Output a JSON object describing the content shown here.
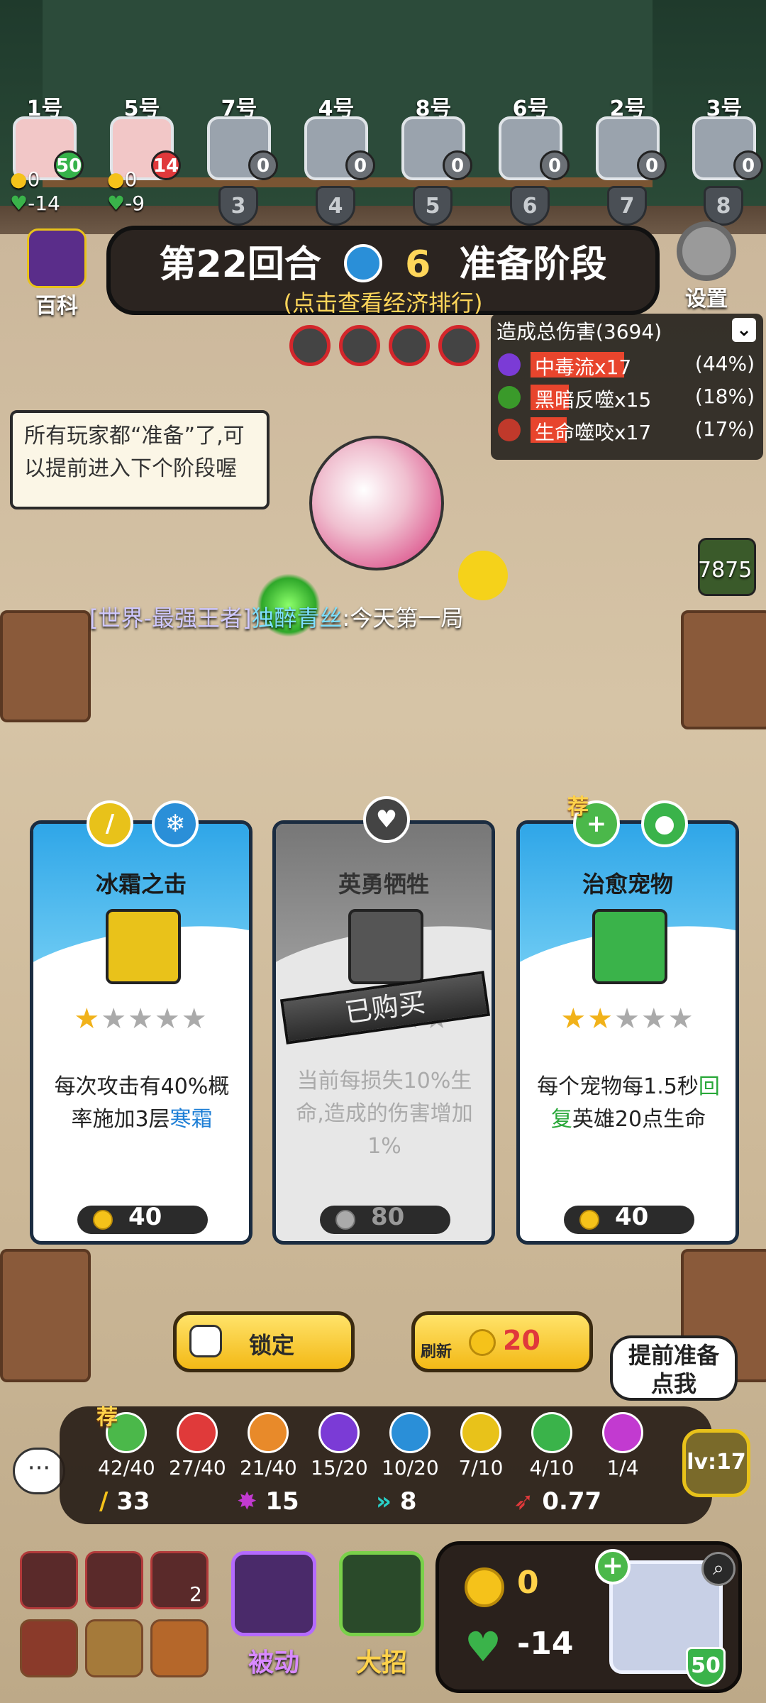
{
  "players": [
    {
      "seat": "1号",
      "level": "50",
      "gold": "0",
      "hp": "-14",
      "is_me": true
    },
    {
      "seat": "5号",
      "level": "14",
      "gold": "0",
      "hp": "-9"
    },
    {
      "seat": "7号",
      "level": "0",
      "rank": "3"
    },
    {
      "seat": "4号",
      "level": "0",
      "rank": "4"
    },
    {
      "seat": "8号",
      "level": "0",
      "rank": "5"
    },
    {
      "seat": "6号",
      "level": "0",
      "rank": "6"
    },
    {
      "seat": "2号",
      "level": "0",
      "rank": "7"
    },
    {
      "seat": "3号",
      "level": "0",
      "rank": "8"
    }
  ],
  "header": {
    "encyclopedia_label": "百科",
    "round_label": "第22回合",
    "timer": "6",
    "phase": "准备阶段",
    "subtitle": "(点击查看经济排行)",
    "settings_label": "设置"
  },
  "damage_panel": {
    "title": "造成总伤害(3694)",
    "rows": [
      {
        "label": "中毒流x17",
        "percent": "(44%)",
        "fill": 0.44,
        "icon_color": "#7b3bd6"
      },
      {
        "label": "黑暗反噬x15",
        "percent": "(18%)",
        "fill": 0.18,
        "icon_color": "#3a9a2a"
      },
      {
        "label": "生命噬咬x17",
        "percent": "(17%)",
        "fill": 0.17,
        "icon_color": "#c0392b"
      }
    ]
  },
  "tooltip": "所有玩家都“准备”了,可以提前进入下个阶段喔",
  "chat_line": {
    "prefix": "[世界-最强王者]",
    "name": "独醉青丝",
    "message": ":今天第一局"
  },
  "gem_counter": "7875",
  "shop": [
    {
      "name": "冰霜之击",
      "stars": 1,
      "desc_a": "每次攻击有40%概率施加3层",
      "desc_b": "寒霜",
      "desc_c": "",
      "price": "40",
      "tags": [
        "sword-icon",
        "snowflake-icon"
      ],
      "icon_color": "#e9c21a"
    },
    {
      "name": "英勇牺牲",
      "stars": 0,
      "desc_a": "当前每损失10%生命,造成的伤害增加1%",
      "desc_b": "",
      "desc_c": "",
      "price": "80",
      "purchased": "已购买",
      "tags": [
        "heart-icon"
      ],
      "icon_color": "#555"
    },
    {
      "name": "治愈宠物",
      "stars": 2,
      "desc_a": "每个宠物每1.5秒",
      "desc_b": "回复",
      "desc_c": "英雄20点生命",
      "price": "40",
      "recommended": "荐",
      "tags": [
        "heal-icon",
        "paw-icon"
      ],
      "icon_color": "#3ab34a"
    }
  ],
  "lock_label": "锁定",
  "refresh_label": "刷新",
  "refresh_cost": "20",
  "ready_bubble": "提前准备点我",
  "synergies": [
    {
      "value": "42/40",
      "color": "#4bb84a",
      "recommended": "荐"
    },
    {
      "value": "27/40",
      "color": "#e03a3a"
    },
    {
      "value": "21/40",
      "color": "#e88a2a"
    },
    {
      "value": "15/20",
      "color": "#7b3bd6"
    },
    {
      "value": "10/20",
      "color": "#2a8fd8"
    },
    {
      "value": "7/10",
      "color": "#e8c21a"
    },
    {
      "value": "4/10",
      "color": "#3ab34a"
    },
    {
      "value": "1/4",
      "color": "#c23ad0"
    }
  ],
  "stats": {
    "attack": "33",
    "crit": "15",
    "speed": "8",
    "attack_speed": "0.77"
  },
  "level_badge": "lv:17",
  "bottom": {
    "passive_label": "被动",
    "ultimate_label": "大招",
    "cart_badge": "2",
    "gold": "0",
    "hp": "-14",
    "hero_level": "50"
  }
}
